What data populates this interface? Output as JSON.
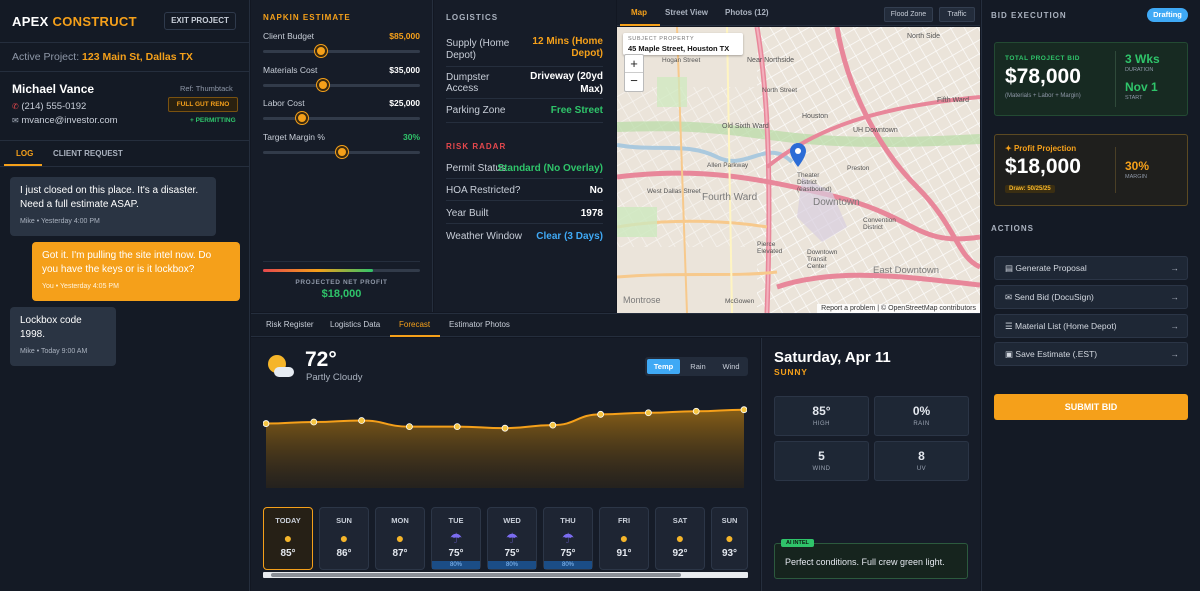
{
  "brand": {
    "name_a": "APEX",
    "name_b": "CONSTRUCT"
  },
  "header": {
    "exit_label": "EXIT PROJECT",
    "project_prefix": "Active Project:",
    "project_name": "123 Main St, Dallas TX"
  },
  "client": {
    "name": "Michael Vance",
    "phone": "(214) 555-0192",
    "email": "mvance@investor.com",
    "ref": "Ref: Thumbtack",
    "scope_badge": "FULL GUT RENO",
    "status": "+ PERMITTING"
  },
  "left_tabs": {
    "log": "LOG",
    "request": "CLIENT REQUEST"
  },
  "messages": [
    {
      "text": "I just closed on this place. It's a disaster. Need a full estimate ASAP.",
      "meta": "Mike • Yesterday 4:00 PM"
    },
    {
      "text": "Got it. I'm pulling the site intel now. Do you have the keys or is it lockbox?",
      "meta": "You • Yesterday 4:05 PM"
    },
    {
      "text": "Lockbox code 1998.",
      "meta": "Mike • Today 9:00 AM"
    }
  ],
  "napkin": {
    "title": "NAPKIN ESTIMATE",
    "budget_label": "Client Budget",
    "budget_value": "$85,000",
    "budget_level": 0.36,
    "materials_label": "Materials Cost",
    "materials_value": "$35,000",
    "materials_level": 0.37,
    "labor_label": "Labor Cost",
    "labor_value": "$25,000",
    "labor_level": 0.23,
    "margin_label": "Target Margin %",
    "margin_value": "30%",
    "margin_level": 0.5,
    "profit_label": "PROJECTED NET PROFIT",
    "profit_value": "$18,000"
  },
  "logistics": {
    "title": "LOGISTICS",
    "supply_label": "Supply (Home Depot)",
    "supply_value": "12 Mins (Home Depot)",
    "dumpster_label": "Dumpster Access",
    "dumpster_value": "Driveway (20yd Max)",
    "parking_label": "Parking Zone",
    "parking_value": "Free Street"
  },
  "risk": {
    "title": "RISK RADAR",
    "permit_label": "Permit Status",
    "permit_value": "Standard (No Overlay)",
    "hoa_label": "HOA Restricted?",
    "hoa_value": "No",
    "year_label": "Year Built",
    "year_value": "1978",
    "weather_label": "Weather Window",
    "weather_value": "Clear (3 Days)"
  },
  "map": {
    "tabs": {
      "map": "Map",
      "street": "Street View",
      "photos": "Photos (12)"
    },
    "flood": "Flood Zone",
    "traffic": "Traffic",
    "subject_label": "SUBJECT PROPERTY",
    "subject_address": "45 Maple Street, Houston TX",
    "zoom_in": "+",
    "zoom_out": "−",
    "attribution": "Report a problem | © OpenStreetMap contributors",
    "places": [
      "North Side",
      "Near Northside",
      "Fifth Ward",
      "Old Sixth Ward",
      "Houston",
      "UH Downtown",
      "Fourth Ward",
      "Downtown",
      "Theater District (eastbound)",
      "Convention District",
      "East Downtown",
      "Pierce Elevated",
      "Downtown Transit Center",
      "Montrose",
      "McGowen",
      "Preston",
      "Allen Parkway",
      "West Dallas Street",
      "North Street",
      "Hogan Street"
    ]
  },
  "center_tabs": [
    "Risk Register",
    "Logistics Data",
    "Forecast",
    "Estimator Photos"
  ],
  "forecast": {
    "temp": "72°",
    "condition": "Partly Cloudy",
    "toggles": [
      "Temp",
      "Rain",
      "Wind"
    ],
    "curve": [
      76,
      77,
      78,
      74,
      74,
      73,
      75,
      82,
      83,
      84,
      85
    ],
    "days": [
      {
        "name": "TODAY",
        "icon": "sun",
        "temp": "85°"
      },
      {
        "name": "SUN",
        "icon": "sun",
        "temp": "86°"
      },
      {
        "name": "MON",
        "icon": "sun",
        "temp": "87°"
      },
      {
        "name": "TUE",
        "icon": "storm",
        "temp": "75°",
        "rain": "80%"
      },
      {
        "name": "WED",
        "icon": "storm",
        "temp": "75°",
        "rain": "80%"
      },
      {
        "name": "THU",
        "icon": "storm",
        "temp": "75°",
        "rain": "80%"
      },
      {
        "name": "FRI",
        "icon": "sun",
        "temp": "91°"
      },
      {
        "name": "SAT",
        "icon": "sun",
        "temp": "92°"
      },
      {
        "name": "SUN",
        "icon": "sun",
        "temp": "93°"
      }
    ],
    "date": "Saturday, Apr 11",
    "summary": "SUNNY",
    "high": "85°",
    "high_label": "HIGH",
    "rain": "0%",
    "rain_label": "RAIN",
    "wind": "5",
    "wind_label": "WIND",
    "uv": "8",
    "uv_label": "UV",
    "ai_badge": "AI INTEL",
    "ai_text": "Perfect conditions. Full crew green light."
  },
  "bid": {
    "title": "BID EXECUTION",
    "status": "Drafting",
    "total_label": "TOTAL PROJECT BID",
    "total_value": "$78,000",
    "total_sub": "(Materials + Labor + Margin)",
    "duration_value": "3 Wks",
    "duration_label": "DURATION",
    "start_value": "Nov 1",
    "start_label": "START",
    "profit_label": "Profit Projection",
    "profit_value": "$18,000",
    "draw": "Draw: 50/25/25",
    "margin_value": "30%",
    "margin_label": "MARGIN",
    "actions_title": "ACTIONS",
    "actions": [
      "Generate Proposal",
      "Send Bid (DocuSign)",
      "Material List (Home Depot)",
      "Save Estimate (.EST)"
    ],
    "submit": "SUBMIT BID"
  },
  "colors": {
    "accent": "#f5a01a",
    "green": "#2fc46a",
    "blue": "#3fa9f5",
    "red": "#e5484d"
  }
}
